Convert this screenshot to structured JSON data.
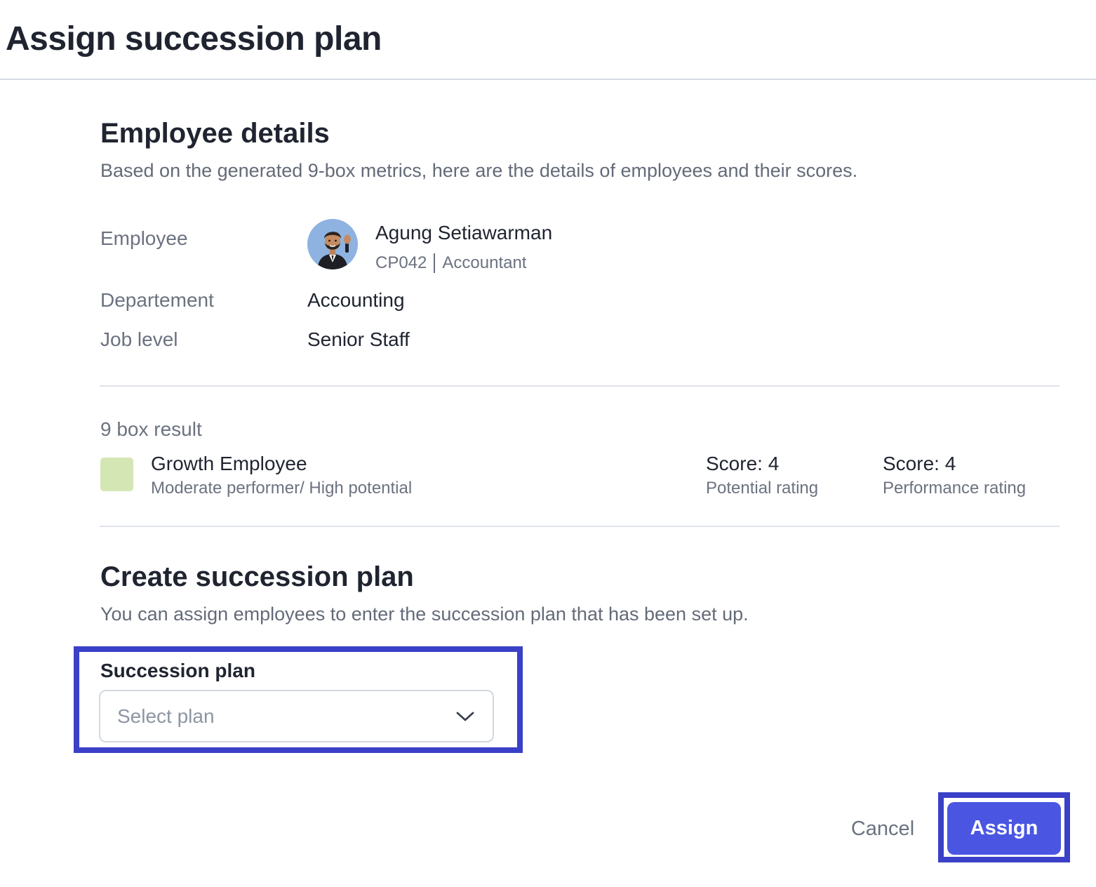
{
  "modal": {
    "title": "Assign succession plan"
  },
  "employee_details": {
    "title": "Employee details",
    "description": "Based on the generated 9-box metrics, here are the details of employees and their scores.",
    "labels": {
      "employee": "Employee",
      "department": "Departement",
      "job_level": "Job level"
    },
    "employee": {
      "name": "Agung Setiawarman",
      "id": "CP042",
      "position": "Accountant",
      "avatar_icon": "memoji-avatar"
    },
    "department": "Accounting",
    "job_level": "Senior Staff"
  },
  "nine_box": {
    "label": "9 box result",
    "category": "Growth Employee",
    "category_description": "Moderate performer/ High potential",
    "category_color": "#d5e6b5",
    "scores": [
      {
        "value": "Score: 4",
        "label": "Potential rating"
      },
      {
        "value": "Score: 4",
        "label": "Performance rating"
      }
    ]
  },
  "succession": {
    "title": "Create succession plan",
    "description": "You can assign employees to enter the succession plan that has been set up.",
    "field_label": "Succession plan",
    "placeholder": "Select plan",
    "icon": "chevron-down-icon"
  },
  "actions": {
    "cancel_label": "Cancel",
    "assign_label": "Assign"
  },
  "colors": {
    "primary": "#4a56e2",
    "highlight": "#3a40c8",
    "text": "#1f2430",
    "muted": "#6b7280"
  }
}
